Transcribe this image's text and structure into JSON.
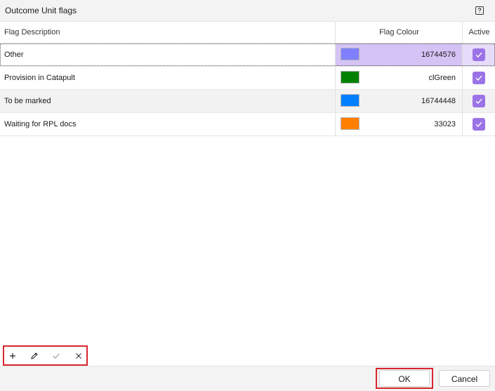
{
  "window": {
    "title": "Outcome Unit flags"
  },
  "grid": {
    "headers": {
      "description": "Flag Description",
      "colour": "Flag Colour",
      "active": "Active"
    },
    "rows": [
      {
        "description": "Other",
        "colour_code": "16744576",
        "swatch": "#8080ff",
        "active": true
      },
      {
        "description": "Provision in Catapult",
        "colour_code": "clGreen",
        "swatch": "#008000",
        "active": true
      },
      {
        "description": "To be marked",
        "colour_code": "16744448",
        "swatch": "#0080ff",
        "active": true
      },
      {
        "description": "Waiting for RPL docs",
        "colour_code": "33023",
        "swatch": "#ff8000",
        "active": true
      }
    ]
  },
  "toolbar": {
    "add_icon": "plus-icon",
    "edit_icon": "pencil-icon",
    "post_icon": "check-icon",
    "cancel_icon": "x-icon"
  },
  "footer": {
    "ok_label": "OK",
    "cancel_label": "Cancel"
  },
  "colors": {
    "accent": "#9b73e6",
    "selection": "#d5c3f5",
    "highlight_border": "#d9262e"
  }
}
